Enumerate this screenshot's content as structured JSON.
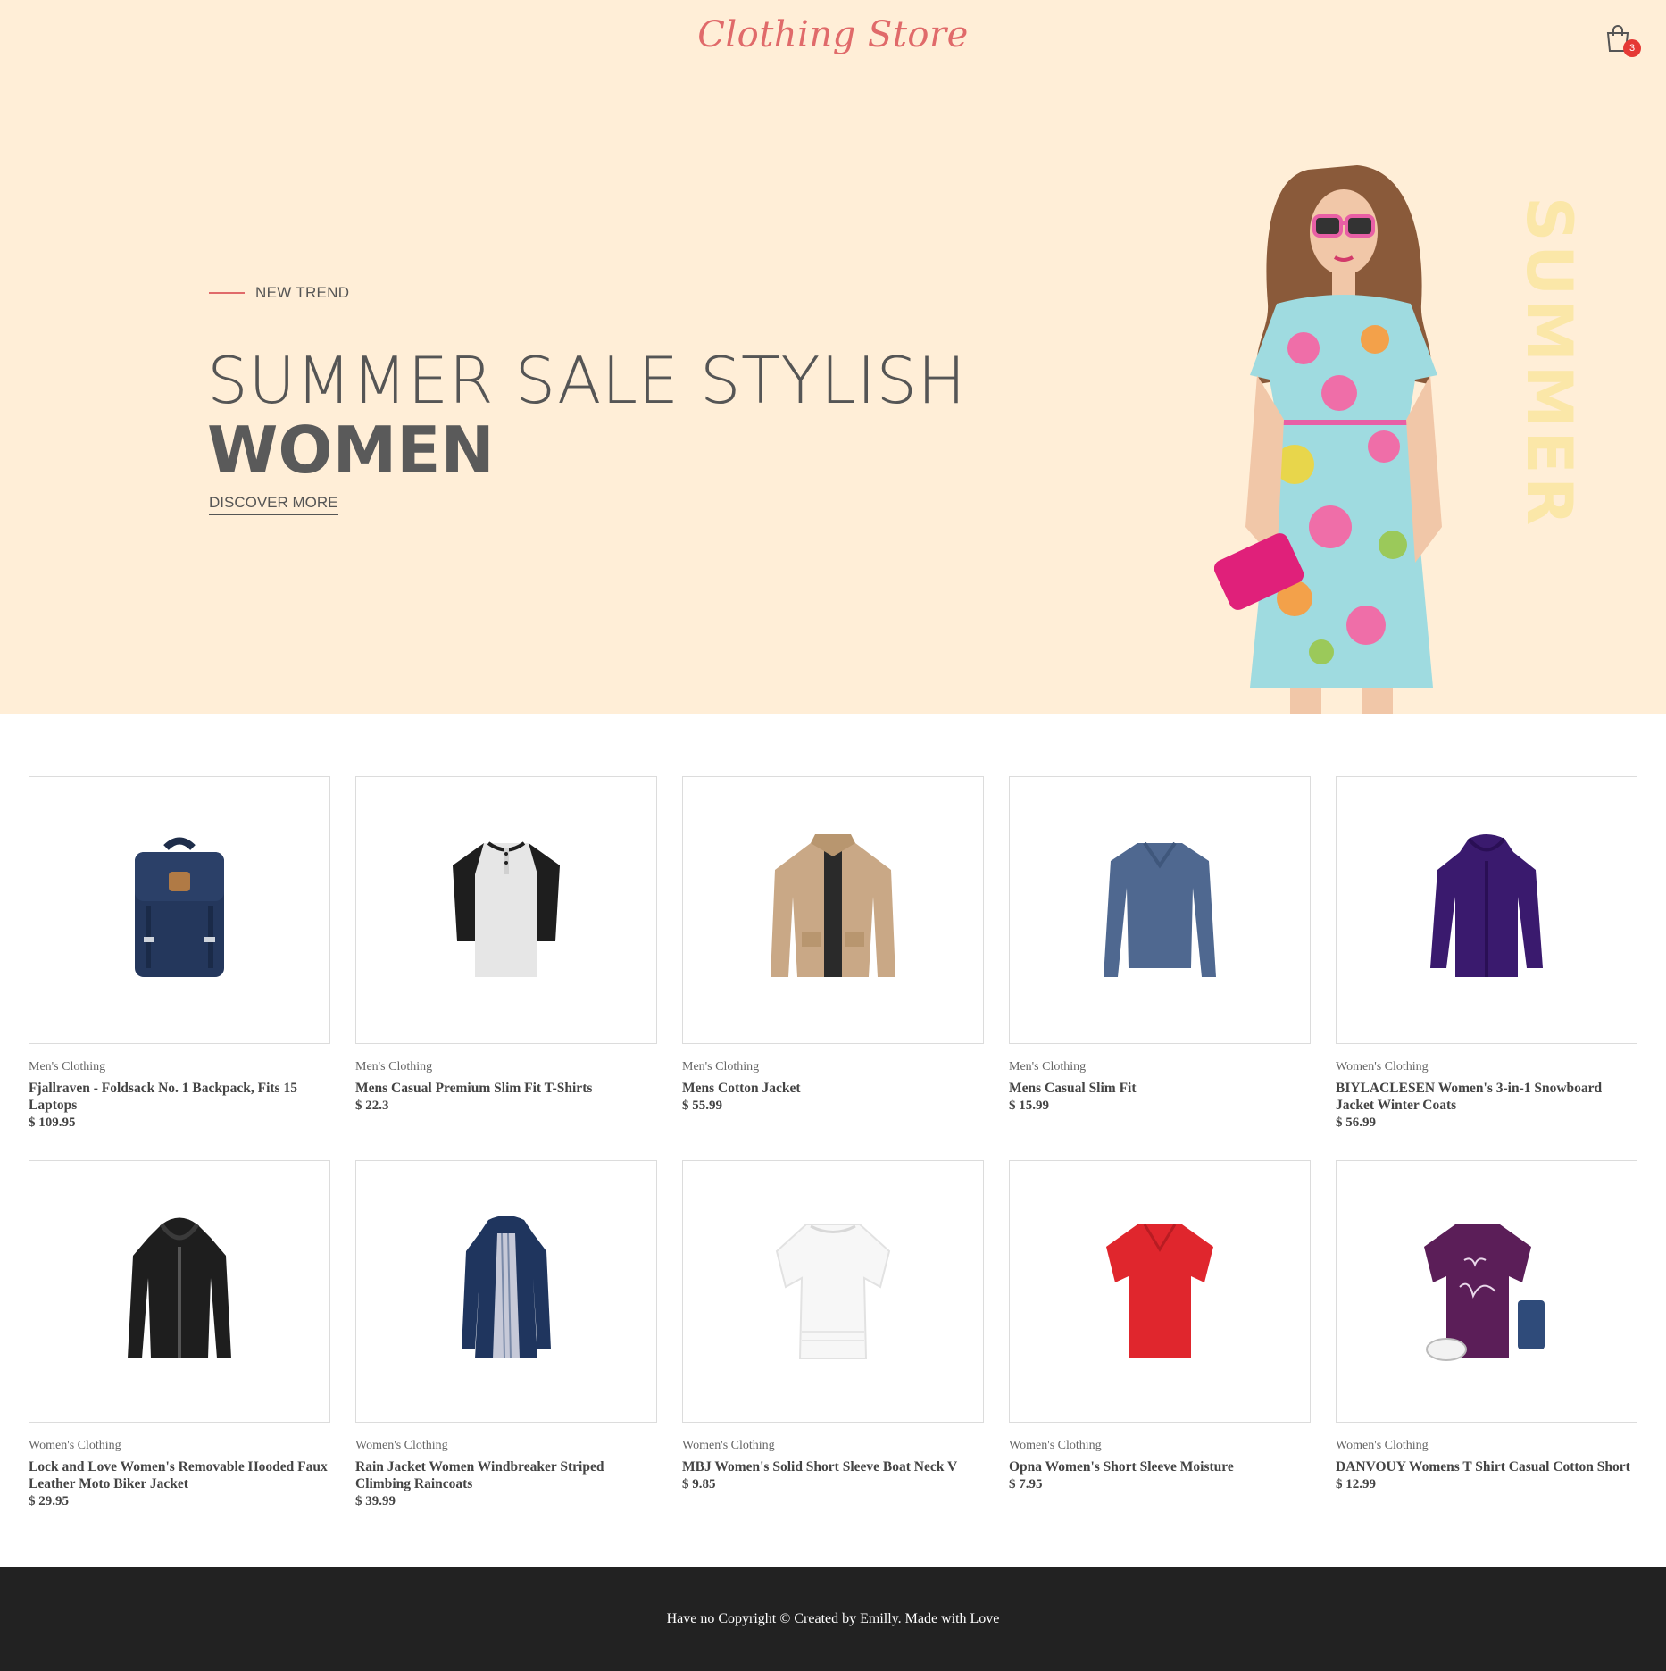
{
  "header": {
    "logo": "Clothing Store",
    "cart_count": "3",
    "cart_icon": "shopping-bag-icon"
  },
  "hero": {
    "eyebrow": "NEW TREND",
    "line1": "SUMMER SALE STYLISH",
    "line2": "WOMEN",
    "cta": "DISCOVER MORE",
    "vertical_word": "SUMMER",
    "bg_color": "#ffeed7",
    "accent_color": "#e06a6a"
  },
  "products": [
    {
      "category": "Men's Clothing",
      "title": "Fjallraven - Foldsack No. 1 Backpack, Fits 15 Laptops",
      "price": "$ 109.95",
      "image": "navy-backpack"
    },
    {
      "category": "Men's Clothing",
      "title": "Mens Casual Premium Slim Fit T-Shirts",
      "price": "$ 22.3",
      "image": "raglan-henley-tshirt"
    },
    {
      "category": "Men's Clothing",
      "title": "Mens Cotton Jacket",
      "price": "$ 55.99",
      "image": "beige-cotton-jacket"
    },
    {
      "category": "Men's Clothing",
      "title": "Mens Casual Slim Fit",
      "price": "$ 15.99",
      "image": "blue-long-sleeve-shirt"
    },
    {
      "category": "Women's Clothing",
      "title": "BIYLACLESEN Women's 3-in-1 Snowboard Jacket Winter Coats",
      "price": "$ 56.99",
      "image": "purple-snowboard-jacket"
    },
    {
      "category": "Women's Clothing",
      "title": "Lock and Love Women's Removable Hooded Faux Leather Moto Biker Jacket",
      "price": "$ 29.95",
      "image": "black-leather-jacket"
    },
    {
      "category": "Women's Clothing",
      "title": "Rain Jacket Women Windbreaker Striped Climbing Raincoats",
      "price": "$ 39.99",
      "image": "navy-raincoat"
    },
    {
      "category": "Women's Clothing",
      "title": "MBJ Women's Solid Short Sleeve Boat Neck V",
      "price": "$ 9.85",
      "image": "white-boat-neck-top"
    },
    {
      "category": "Women's Clothing",
      "title": "Opna Women's Short Sleeve Moisture",
      "price": "$ 7.95",
      "image": "red-v-neck-tshirt"
    },
    {
      "category": "Women's Clothing",
      "title": "DANVOUY Womens T Shirt Casual Cotton Short",
      "price": "$ 12.99",
      "image": "purple-be-kind-tshirt"
    }
  ],
  "footer": {
    "text": "Have no Copyright © Created by Emilly. Made with Love"
  }
}
